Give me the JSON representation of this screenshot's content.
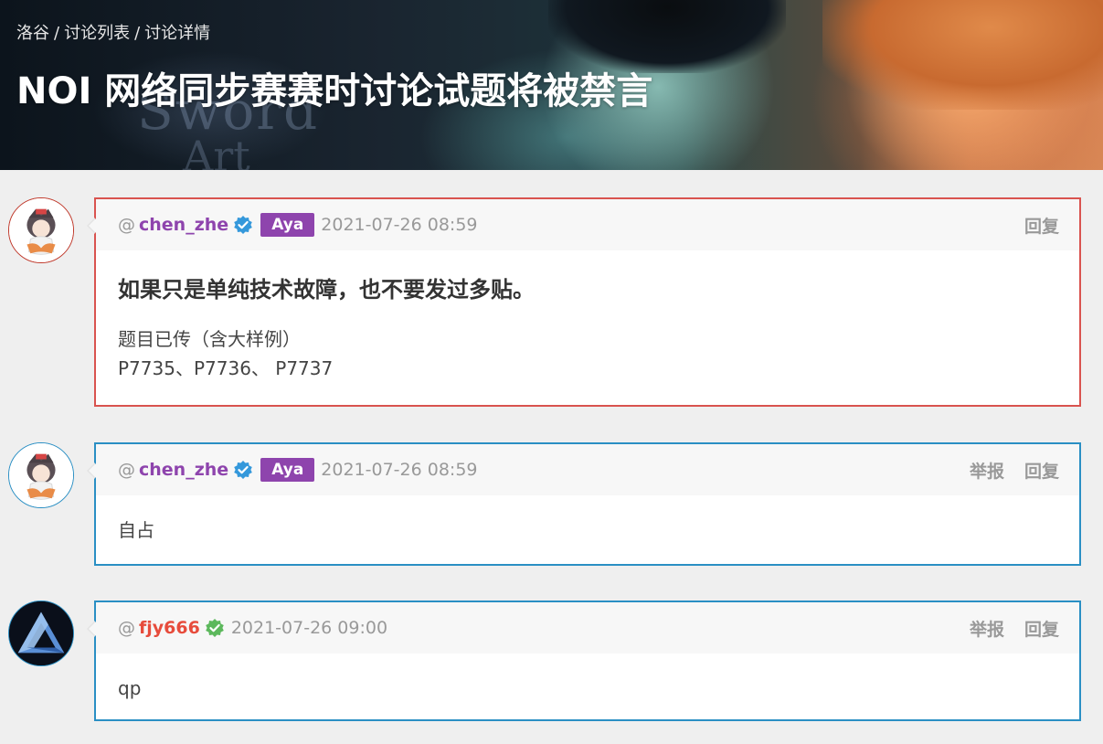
{
  "breadcrumb": {
    "items": [
      "洛谷",
      "讨论列表",
      "讨论详情"
    ],
    "separator": "/"
  },
  "title": "NOI 网络同步赛赛时讨论试题将被禁言",
  "colors": {
    "purple_user": "#8e44ad",
    "red_user": "#e74c3c",
    "badge": "#8e44ad",
    "border_red": "#d9534f",
    "border_blue": "#2a8fc4"
  },
  "posts": [
    {
      "at": "@",
      "username": "chen_zhe",
      "verified_icon": "blue-check-icon",
      "badge": "Aya",
      "time": "2021-07-26 08:59",
      "actions": [
        "回复"
      ],
      "heading": "如果只是单纯技术故障，也不要发过多贴。",
      "lines": [
        "题目已传（含大样例）",
        "P7735、P7736、 P7737"
      ]
    },
    {
      "at": "@",
      "username": "chen_zhe",
      "verified_icon": "blue-check-icon",
      "badge": "Aya",
      "time": "2021-07-26 08:59",
      "actions": [
        "举报",
        "回复"
      ],
      "lines": [
        "自占"
      ]
    },
    {
      "at": "@",
      "username": "fjy666",
      "verified_icon": "green-check-icon",
      "time": "2021-07-26 09:00",
      "actions": [
        "举报",
        "回复"
      ],
      "lines": [
        "qp"
      ]
    }
  ]
}
